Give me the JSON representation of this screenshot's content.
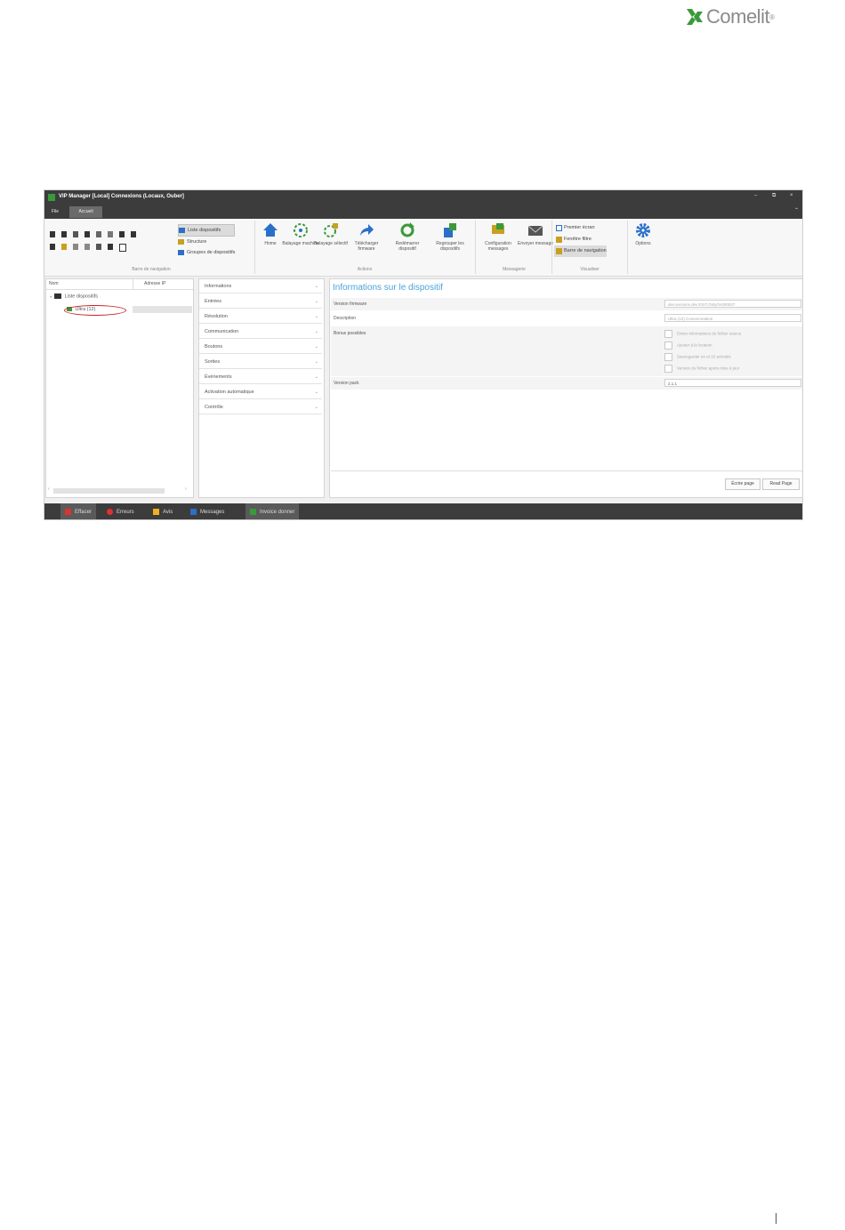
{
  "brand": {
    "name": "Comelit",
    "registered": "®"
  },
  "window": {
    "title": "VIP Manager [Local] Connexions (Locaux, Ouber]",
    "controls": [
      "–",
      "⧉",
      "×"
    ]
  },
  "tabs": {
    "file": "File",
    "home": "Accueil"
  },
  "ribbon": {
    "nav_group_label": "Barre de navigation",
    "nav_items": [
      "Liste dispositifs",
      "Structure",
      "Groupes de dispositifs"
    ],
    "actions_group_label": "Actions",
    "actions": [
      {
        "label": "Home",
        "icon": "home-icon",
        "color": "#2a6fc9"
      },
      {
        "label": "Balayage machine",
        "icon": "scan-machine-icon",
        "color": "#3a9a3a"
      },
      {
        "label": "Balayage sélectif",
        "icon": "scan-selective-icon",
        "color": "#3a9a3a"
      },
      {
        "label": "Télécharger firmware",
        "icon": "upload-arrow-icon",
        "color": "#2a6fc9"
      },
      {
        "label": "Redémarrer dispositif",
        "icon": "refresh-icon",
        "color": "#3a9a3a"
      },
      {
        "label": "Regrouper les dispositifs",
        "icon": "group-devices-icon",
        "color": "#2a6fc9"
      }
    ],
    "messaging_group_label": "Messagerie",
    "messaging": [
      {
        "label": "Configuration messages",
        "icon": "config-messages-icon"
      },
      {
        "label": "Envoyer message",
        "icon": "envelope-icon"
      }
    ],
    "view_group_label": "Visualiser",
    "view_items": [
      "Premier écran",
      "Fenêtre filtre",
      "Barre de navigation"
    ],
    "options": {
      "label": "Options",
      "icon": "gear-icon"
    }
  },
  "tree": {
    "col_name": "Nom",
    "col_address": "Adresse IP",
    "root": "Liste dispositifs",
    "device": "Ultra (12)"
  },
  "accordion": [
    "Informations",
    "Entrées",
    "Résolution",
    "Communication",
    "Boutons",
    "Sorties",
    "Événements",
    "Activation automatique",
    "Contrôle"
  ],
  "detail": {
    "title": "Informations sur le dispositif",
    "rows": [
      {
        "label": "Version firmware",
        "value": "dev.versions.dev.EXIT.OnlyOn000027"
      },
      {
        "label": "Description",
        "value": "Ultra (12)          Consommation"
      },
      {
        "label": "Bonus possibles",
        "value": ""
      },
      {
        "label": "Version pack",
        "value": "2.1.1"
      }
    ],
    "checkboxes": [
      "Entrer informations du fichier source",
      "Ajouter à la location",
      "Sauvegarder en et 10 activités",
      "Version du fichier après mise à jour"
    ],
    "btn_write": "Écrire page",
    "btn_read": "Read Page"
  },
  "status": [
    {
      "label": "Effacer",
      "color": "#e03030"
    },
    {
      "label": "Erreurs",
      "color": "#e03030"
    },
    {
      "label": "Avis",
      "color": "#f0b020"
    },
    {
      "label": "Messages",
      "color": "#2a6fc9"
    },
    {
      "label": "Invoice donner",
      "color": "#3a9a3a"
    }
  ]
}
